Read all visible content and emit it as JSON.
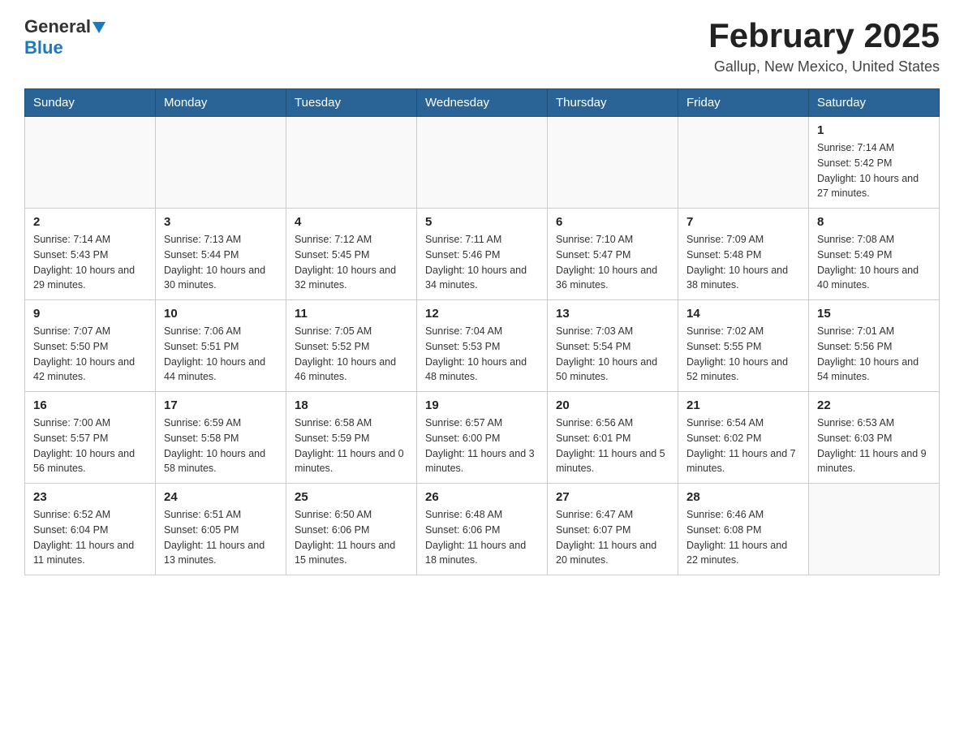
{
  "header": {
    "logo_general": "General",
    "logo_blue": "Blue",
    "month_title": "February 2025",
    "location": "Gallup, New Mexico, United States"
  },
  "days_of_week": [
    "Sunday",
    "Monday",
    "Tuesday",
    "Wednesday",
    "Thursday",
    "Friday",
    "Saturday"
  ],
  "weeks": [
    [
      {
        "day": "",
        "info": ""
      },
      {
        "day": "",
        "info": ""
      },
      {
        "day": "",
        "info": ""
      },
      {
        "day": "",
        "info": ""
      },
      {
        "day": "",
        "info": ""
      },
      {
        "day": "",
        "info": ""
      },
      {
        "day": "1",
        "info": "Sunrise: 7:14 AM\nSunset: 5:42 PM\nDaylight: 10 hours and 27 minutes."
      }
    ],
    [
      {
        "day": "2",
        "info": "Sunrise: 7:14 AM\nSunset: 5:43 PM\nDaylight: 10 hours and 29 minutes."
      },
      {
        "day": "3",
        "info": "Sunrise: 7:13 AM\nSunset: 5:44 PM\nDaylight: 10 hours and 30 minutes."
      },
      {
        "day": "4",
        "info": "Sunrise: 7:12 AM\nSunset: 5:45 PM\nDaylight: 10 hours and 32 minutes."
      },
      {
        "day": "5",
        "info": "Sunrise: 7:11 AM\nSunset: 5:46 PM\nDaylight: 10 hours and 34 minutes."
      },
      {
        "day": "6",
        "info": "Sunrise: 7:10 AM\nSunset: 5:47 PM\nDaylight: 10 hours and 36 minutes."
      },
      {
        "day": "7",
        "info": "Sunrise: 7:09 AM\nSunset: 5:48 PM\nDaylight: 10 hours and 38 minutes."
      },
      {
        "day": "8",
        "info": "Sunrise: 7:08 AM\nSunset: 5:49 PM\nDaylight: 10 hours and 40 minutes."
      }
    ],
    [
      {
        "day": "9",
        "info": "Sunrise: 7:07 AM\nSunset: 5:50 PM\nDaylight: 10 hours and 42 minutes."
      },
      {
        "day": "10",
        "info": "Sunrise: 7:06 AM\nSunset: 5:51 PM\nDaylight: 10 hours and 44 minutes."
      },
      {
        "day": "11",
        "info": "Sunrise: 7:05 AM\nSunset: 5:52 PM\nDaylight: 10 hours and 46 minutes."
      },
      {
        "day": "12",
        "info": "Sunrise: 7:04 AM\nSunset: 5:53 PM\nDaylight: 10 hours and 48 minutes."
      },
      {
        "day": "13",
        "info": "Sunrise: 7:03 AM\nSunset: 5:54 PM\nDaylight: 10 hours and 50 minutes."
      },
      {
        "day": "14",
        "info": "Sunrise: 7:02 AM\nSunset: 5:55 PM\nDaylight: 10 hours and 52 minutes."
      },
      {
        "day": "15",
        "info": "Sunrise: 7:01 AM\nSunset: 5:56 PM\nDaylight: 10 hours and 54 minutes."
      }
    ],
    [
      {
        "day": "16",
        "info": "Sunrise: 7:00 AM\nSunset: 5:57 PM\nDaylight: 10 hours and 56 minutes."
      },
      {
        "day": "17",
        "info": "Sunrise: 6:59 AM\nSunset: 5:58 PM\nDaylight: 10 hours and 58 minutes."
      },
      {
        "day": "18",
        "info": "Sunrise: 6:58 AM\nSunset: 5:59 PM\nDaylight: 11 hours and 0 minutes."
      },
      {
        "day": "19",
        "info": "Sunrise: 6:57 AM\nSunset: 6:00 PM\nDaylight: 11 hours and 3 minutes."
      },
      {
        "day": "20",
        "info": "Sunrise: 6:56 AM\nSunset: 6:01 PM\nDaylight: 11 hours and 5 minutes."
      },
      {
        "day": "21",
        "info": "Sunrise: 6:54 AM\nSunset: 6:02 PM\nDaylight: 11 hours and 7 minutes."
      },
      {
        "day": "22",
        "info": "Sunrise: 6:53 AM\nSunset: 6:03 PM\nDaylight: 11 hours and 9 minutes."
      }
    ],
    [
      {
        "day": "23",
        "info": "Sunrise: 6:52 AM\nSunset: 6:04 PM\nDaylight: 11 hours and 11 minutes."
      },
      {
        "day": "24",
        "info": "Sunrise: 6:51 AM\nSunset: 6:05 PM\nDaylight: 11 hours and 13 minutes."
      },
      {
        "day": "25",
        "info": "Sunrise: 6:50 AM\nSunset: 6:06 PM\nDaylight: 11 hours and 15 minutes."
      },
      {
        "day": "26",
        "info": "Sunrise: 6:48 AM\nSunset: 6:06 PM\nDaylight: 11 hours and 18 minutes."
      },
      {
        "day": "27",
        "info": "Sunrise: 6:47 AM\nSunset: 6:07 PM\nDaylight: 11 hours and 20 minutes."
      },
      {
        "day": "28",
        "info": "Sunrise: 6:46 AM\nSunset: 6:08 PM\nDaylight: 11 hours and 22 minutes."
      },
      {
        "day": "",
        "info": ""
      }
    ]
  ]
}
